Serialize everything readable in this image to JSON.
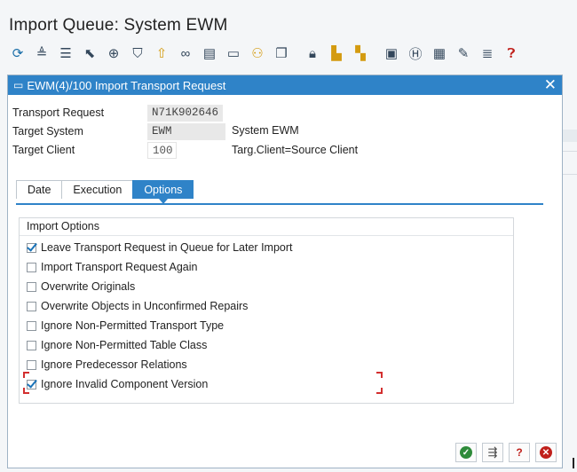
{
  "app": {
    "title": "Import Queue: System EWM"
  },
  "toolbar": {
    "icons": [
      "refresh-icon",
      "sort-asc-icon",
      "filter-list-icon",
      "select-cursor-icon",
      "zoom-icon",
      "filter-icon",
      "upload-icon",
      "glasses-icon",
      "document-icon",
      "display-icon",
      "tree-icon",
      "copy-icon",
      "lock-icon",
      "transport-icon",
      "truck-icon",
      "monitor-icon",
      "h-icon",
      "settings-doc-icon",
      "user-edit-icon",
      "list-icon",
      "help-icon"
    ]
  },
  "dialog": {
    "title": "EWM(4)/100 Import Transport Request",
    "fields": {
      "transport_request": {
        "label": "Transport Request",
        "value": "N71K902646"
      },
      "target_system": {
        "label": "Target System",
        "value": "EWM",
        "description": "System EWM"
      },
      "target_client": {
        "label": "Target Client",
        "value": "100",
        "description": "Targ.Client=Source Client"
      }
    },
    "tabs": [
      "Date",
      "Execution",
      "Options"
    ],
    "active_tab": "Options",
    "group_title": "Import Options",
    "options": [
      {
        "label": "Leave Transport Request in Queue for Later Import",
        "checked": true
      },
      {
        "label": "Import Transport Request Again",
        "checked": false
      },
      {
        "label": "Overwrite Originals",
        "checked": false
      },
      {
        "label": "Overwrite Objects in Unconfirmed Repairs",
        "checked": false
      },
      {
        "label": "Ignore Non-Permitted Transport Type",
        "checked": false
      },
      {
        "label": "Ignore Non-Permitted Table Class",
        "checked": false
      },
      {
        "label": "Ignore Predecessor Relations",
        "checked": false
      },
      {
        "label": "Ignore Invalid Component Version",
        "checked": true
      }
    ],
    "footer_buttons": [
      "confirm-icon",
      "schedule-icon",
      "help-icon",
      "cancel-icon"
    ]
  },
  "colors": {
    "accent": "#2f83c8",
    "ok": "#2e8b3a",
    "danger": "#c0201b"
  }
}
